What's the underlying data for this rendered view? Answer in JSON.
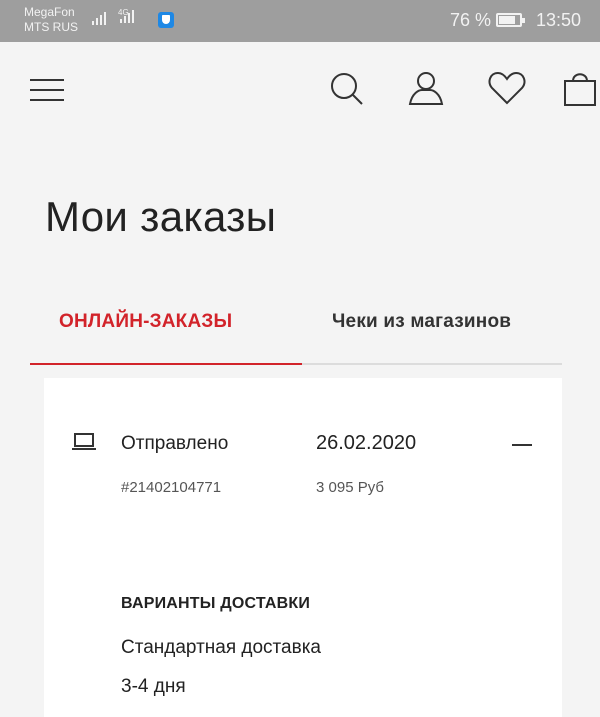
{
  "status_bar": {
    "carrier_1": "MegaFon",
    "carrier_2": "MTS RUS",
    "network": "4G",
    "battery_percent": "76 %",
    "battery_level": 0.76,
    "time": "13:50"
  },
  "header": {
    "icons": [
      "menu-icon",
      "search-icon",
      "account-icon",
      "heart-icon",
      "shopping-bag-icon"
    ]
  },
  "page": {
    "title": "Мои заказы"
  },
  "tabs": {
    "items": [
      {
        "label": "ОНЛАЙН-ЗАКАЗЫ",
        "active": true
      },
      {
        "label": "Чеки из магазинов",
        "active": false
      }
    ]
  },
  "order": {
    "status": "Отправлено",
    "number": "#21402104771",
    "date": "26.02.2020",
    "price": "3 095 Руб",
    "delivery_heading": "ВАРИАНТЫ ДОСТАВКИ",
    "delivery_type": "Стандартная доставка",
    "delivery_days": "3-4 дня"
  },
  "colors": {
    "accent": "#d2232a",
    "status_bar_bg": "#9e9e9e",
    "page_bg": "#f4f4f4",
    "card_bg": "#ffffff"
  }
}
